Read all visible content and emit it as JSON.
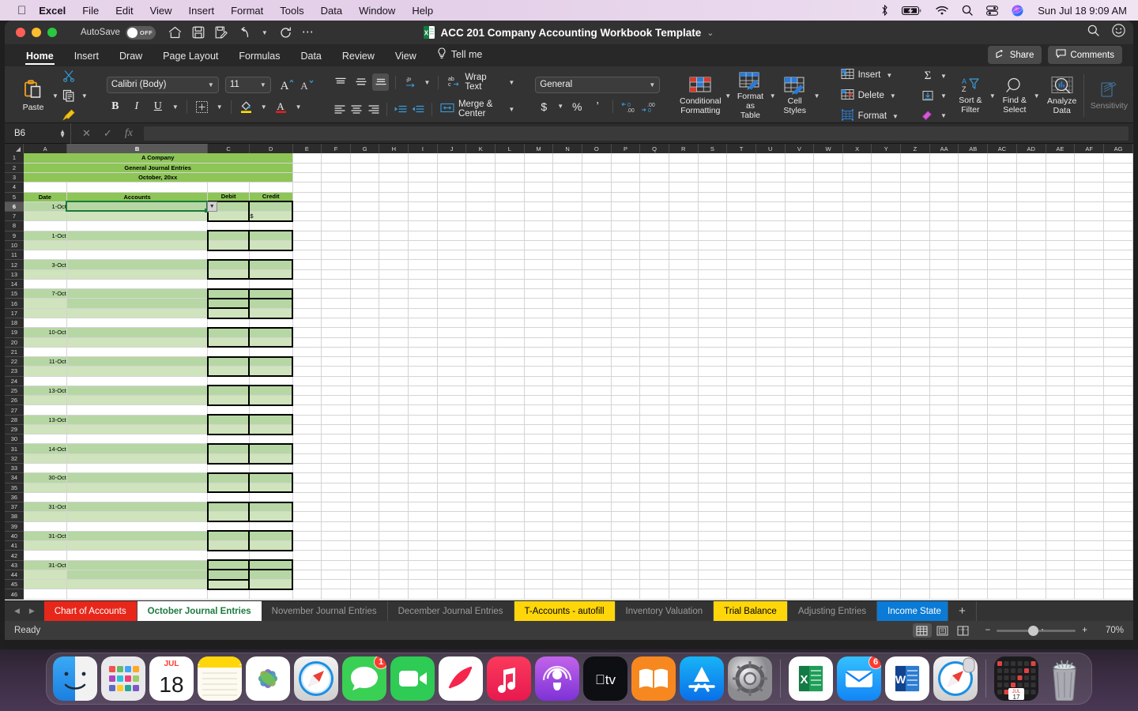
{
  "menubar": {
    "apple_icon": "apple-icon",
    "items": [
      {
        "label": "Excel",
        "bold": true
      },
      {
        "label": "File"
      },
      {
        "label": "Edit"
      },
      {
        "label": "View"
      },
      {
        "label": "Insert"
      },
      {
        "label": "Format"
      },
      {
        "label": "Tools"
      },
      {
        "label": "Data"
      },
      {
        "label": "Window"
      },
      {
        "label": "Help"
      }
    ],
    "status_icons": [
      "bluetooth-icon",
      "battery-charging-icon",
      "wifi-icon",
      "spotlight-search-icon",
      "control-center-icon",
      "siri-icon"
    ],
    "clock": "Sun Jul 18  9:09 AM"
  },
  "titlebar": {
    "autosave_label": "AutoSave",
    "autosave_state": "OFF",
    "quick_access": [
      "home-icon",
      "save-icon",
      "save-as-icon",
      "undo-icon",
      "undo-chevron-icon",
      "redo-icon",
      "more-icon"
    ],
    "document_title": "ACC 201 Company Accounting Workbook Template",
    "title_chevron": "⌄",
    "search_icon": "search-icon",
    "account_icon": "account-smiley-icon"
  },
  "ribbon_tabs": {
    "tabs": [
      {
        "label": "Home",
        "active": true
      },
      {
        "label": "Insert",
        "active": false
      },
      {
        "label": "Draw",
        "active": false
      },
      {
        "label": "Page Layout",
        "active": false
      },
      {
        "label": "Formulas",
        "active": false
      },
      {
        "label": "Data",
        "active": false
      },
      {
        "label": "Review",
        "active": false
      },
      {
        "label": "View",
        "active": false
      }
    ],
    "tell_me": "Tell me",
    "share_label": "Share",
    "comments_label": "Comments"
  },
  "ribbon": {
    "clipboard": {
      "paste_label": "Paste",
      "cut_icon": "scissors-icon",
      "copy_icon": "copy-icon",
      "format_painter_icon": "format-painter-icon"
    },
    "font": {
      "family": "Calibri (Body)",
      "size": "11",
      "grow_label": "A",
      "shrink_label": "A",
      "bold": "B",
      "italic": "I",
      "underline": "U",
      "borders_icon": "borders-icon",
      "fill_color_icon": "fill-color-icon",
      "font_color_icon": "font-color-icon"
    },
    "alignment": {
      "top_align_icon": "align-top-icon",
      "middle_align_icon": "align-middle-icon",
      "bottom_align_icon": "align-bottom-icon",
      "orientation_icon": "text-orientation-icon",
      "left_align_icon": "align-left-icon",
      "center_align_icon": "align-center-icon",
      "right_align_icon": "align-right-icon",
      "decrease_indent_icon": "decrease-indent-icon",
      "increase_indent_icon": "increase-indent-icon",
      "wrap_text_label": "Wrap Text",
      "merge_center_label": "Merge & Center"
    },
    "number": {
      "format": "General",
      "currency_icon": "currency-icon",
      "percent_icon": "percent-icon",
      "comma_icon": "comma-style-icon",
      "increase_decimal_icon": "increase-decimal-icon",
      "decrease_decimal_icon": "decrease-decimal-icon"
    },
    "styles": {
      "conditional_formatting": "Conditional\nFormatting",
      "conditional_formatting_l1": "Conditional",
      "conditional_formatting_l2": "Formatting",
      "format_as_table_l1": "Format",
      "format_as_table_l2": "as Table",
      "cell_styles_l1": "Cell",
      "cell_styles_l2": "Styles"
    },
    "cells": {
      "insert_label": "Insert",
      "delete_label": "Delete",
      "format_label": "Format"
    },
    "editing": {
      "autosum_icon": "autosum-icon",
      "fill_icon": "fill-down-icon",
      "clear_icon": "clear-eraser-icon",
      "sort_filter_l1": "Sort &",
      "sort_filter_l2": "Filter",
      "find_select_l1": "Find &",
      "find_select_l2": "Select",
      "analyze_data_l1": "Analyze",
      "analyze_data_l2": "Data",
      "sensitivity_label": "Sensitivity"
    }
  },
  "formula_bar": {
    "name_box": "B6",
    "cancel_icon": "cancel-x-icon",
    "enter_icon": "enter-check-icon",
    "function_icon": "insert-function-icon",
    "formula_value": ""
  },
  "sheet": {
    "columns": [
      "A",
      "B",
      "C",
      "D",
      "E",
      "F",
      "G",
      "H",
      "I",
      "J",
      "K",
      "L",
      "M",
      "N",
      "O",
      "P",
      "Q",
      "R",
      "S",
      "T",
      "U",
      "V",
      "W",
      "X",
      "Y",
      "Z",
      "AA",
      "AB",
      "AC",
      "AD",
      "AE",
      "AF",
      "AG"
    ],
    "selected_column": "B",
    "selected_row": 6,
    "title_block": {
      "line1": "A Company",
      "line2": "General Journal Entries",
      "line3": "October, 20xx"
    },
    "headers": {
      "date": "Date",
      "accounts": "Accounts",
      "debit": "Debit",
      "credit": "Credit"
    },
    "rows": [
      {
        "n": 1,
        "kind": "title",
        "text": "A Company"
      },
      {
        "n": 2,
        "kind": "title",
        "text": "General Journal Entries"
      },
      {
        "n": 3,
        "kind": "title",
        "text": "October, 20xx"
      },
      {
        "n": 4,
        "kind": "blank"
      },
      {
        "n": 5,
        "kind": "header"
      },
      {
        "n": 6,
        "kind": "entry1",
        "date": "1-Oct",
        "debit": "",
        "credit": ""
      },
      {
        "n": 7,
        "kind": "entry2",
        "date": "",
        "debit": "",
        "credit": "$"
      },
      {
        "n": 8,
        "kind": "blank"
      },
      {
        "n": 9,
        "kind": "entry1",
        "date": "1-Oct",
        "debit": "",
        "credit": ""
      },
      {
        "n": 10,
        "kind": "entry2",
        "date": "",
        "debit": "",
        "credit": ""
      },
      {
        "n": 11,
        "kind": "blank"
      },
      {
        "n": 12,
        "kind": "entry1",
        "date": "3-Oct",
        "debit": "",
        "credit": ""
      },
      {
        "n": 13,
        "kind": "entry2",
        "date": "",
        "debit": "",
        "credit": ""
      },
      {
        "n": 14,
        "kind": "blank"
      },
      {
        "n": 15,
        "kind": "entry1",
        "date": "7-Oct",
        "debit": "",
        "credit": ""
      },
      {
        "n": 16,
        "kind": "entry1b",
        "date": "",
        "debit": "",
        "credit": ""
      },
      {
        "n": 17,
        "kind": "entry2",
        "date": "",
        "debit": "",
        "credit": ""
      },
      {
        "n": 18,
        "kind": "blank"
      },
      {
        "n": 19,
        "kind": "entry1",
        "date": "10-Oct",
        "debit": "",
        "credit": ""
      },
      {
        "n": 20,
        "kind": "entry2",
        "date": "",
        "debit": "",
        "credit": ""
      },
      {
        "n": 21,
        "kind": "blank"
      },
      {
        "n": 22,
        "kind": "entry1",
        "date": "11-Oct",
        "debit": "",
        "credit": ""
      },
      {
        "n": 23,
        "kind": "entry2",
        "date": "",
        "debit": "",
        "credit": ""
      },
      {
        "n": 24,
        "kind": "blank"
      },
      {
        "n": 25,
        "kind": "entry1",
        "date": "13-Oct",
        "debit": "",
        "credit": ""
      },
      {
        "n": 26,
        "kind": "entry2",
        "date": "",
        "debit": "",
        "credit": ""
      },
      {
        "n": 27,
        "kind": "blank"
      },
      {
        "n": 28,
        "kind": "entry1",
        "date": "13-Oct",
        "debit": "",
        "credit": ""
      },
      {
        "n": 29,
        "kind": "entry2",
        "date": "",
        "debit": "",
        "credit": ""
      },
      {
        "n": 30,
        "kind": "blank"
      },
      {
        "n": 31,
        "kind": "entry1",
        "date": "14-Oct",
        "debit": "",
        "credit": ""
      },
      {
        "n": 32,
        "kind": "entry2",
        "date": "",
        "debit": "",
        "credit": ""
      },
      {
        "n": 33,
        "kind": "blank"
      },
      {
        "n": 34,
        "kind": "entry1",
        "date": "30-Oct",
        "debit": "",
        "credit": ""
      },
      {
        "n": 35,
        "kind": "entry2",
        "date": "",
        "debit": "",
        "credit": ""
      },
      {
        "n": 36,
        "kind": "blank"
      },
      {
        "n": 37,
        "kind": "entry1",
        "date": "31-Oct",
        "debit": "",
        "credit": ""
      },
      {
        "n": 38,
        "kind": "entry2",
        "date": "",
        "debit": "",
        "credit": ""
      },
      {
        "n": 39,
        "kind": "blank"
      },
      {
        "n": 40,
        "kind": "entry1",
        "date": "31-Oct",
        "debit": "",
        "credit": ""
      },
      {
        "n": 41,
        "kind": "entry2",
        "date": "",
        "debit": "",
        "credit": ""
      },
      {
        "n": 42,
        "kind": "blank"
      },
      {
        "n": 43,
        "kind": "entry1",
        "date": "31-Oct",
        "debit": "",
        "credit": ""
      },
      {
        "n": 44,
        "kind": "entry1b",
        "date": "",
        "debit": "",
        "credit": ""
      },
      {
        "n": 45,
        "kind": "entry2",
        "date": "",
        "debit": "",
        "credit": ""
      },
      {
        "n": 46,
        "kind": "blank"
      }
    ]
  },
  "sheet_tabs": {
    "prev_icon": "nav-prev-icon",
    "next_icon": "nav-next-icon",
    "add_icon": "add-sheet-icon",
    "tabs": [
      {
        "label": "Chart of Accounts",
        "color": "#e8271b",
        "text": "#ffffff",
        "active": false
      },
      {
        "label": "October Journal Entries",
        "color": "#ffffff",
        "text": "#1c7a3e",
        "active": true
      },
      {
        "label": "November Journal Entries",
        "color": "",
        "text": "#9b9b9b",
        "active": false
      },
      {
        "label": "December Journal Entries",
        "color": "",
        "text": "#9b9b9b",
        "active": false
      },
      {
        "label": "T-Accounts - autofill",
        "color": "#ffd60a",
        "text": "#000000",
        "active": false
      },
      {
        "label": "Inventory Valuation",
        "color": "",
        "text": "#9b9b9b",
        "active": false
      },
      {
        "label": "Trial Balance",
        "color": "#ffd60a",
        "text": "#000000",
        "active": false
      },
      {
        "label": "Adjusting Entries",
        "color": "",
        "text": "#9b9b9b",
        "active": false
      },
      {
        "label": "Income State",
        "color": "#0a7bd6",
        "text": "#ffffff",
        "active": false
      }
    ]
  },
  "status_bar": {
    "status": "Ready",
    "view_normal_icon": "view-normal-icon",
    "view_layout_icon": "view-page-layout-icon",
    "view_break_icon": "view-page-break-icon",
    "zoom_out": "−",
    "zoom_in": "+",
    "zoom_level": "70%"
  },
  "dock": {
    "items": [
      {
        "name": "finder",
        "running": true
      },
      {
        "name": "launchpad",
        "running": true
      },
      {
        "name": "calendar",
        "running": false,
        "month": "JUL",
        "day": "18"
      },
      {
        "name": "notes",
        "running": true
      },
      {
        "name": "photos",
        "running": true
      },
      {
        "name": "safari",
        "running": false
      },
      {
        "name": "messages",
        "running": false,
        "badge": "1"
      },
      {
        "name": "facetime",
        "running": false
      },
      {
        "name": "news",
        "running": false
      },
      {
        "name": "music",
        "running": false
      },
      {
        "name": "podcasts",
        "running": false
      },
      {
        "name": "appletv",
        "running": false
      },
      {
        "name": "books",
        "running": false
      },
      {
        "name": "app-store",
        "running": false
      },
      {
        "name": "system-settings",
        "running": false
      },
      {
        "name": "excel",
        "running": true
      },
      {
        "name": "mail",
        "running": true,
        "badge": "6"
      },
      {
        "name": "word",
        "running": false
      },
      {
        "name": "safari-2",
        "running": false
      },
      {
        "name": "stocks-widget",
        "running": false
      },
      {
        "name": "trash",
        "running": false
      }
    ]
  },
  "colors": {
    "header_green": "#8dc556",
    "row_green_dark": "#b6d7a3",
    "row_green_light": "#cfe3bc",
    "active_cell": "#1a7a3c",
    "tab_red": "#e8271b",
    "tab_yellow": "#ffd60a",
    "tab_blue": "#0a7bd6"
  }
}
